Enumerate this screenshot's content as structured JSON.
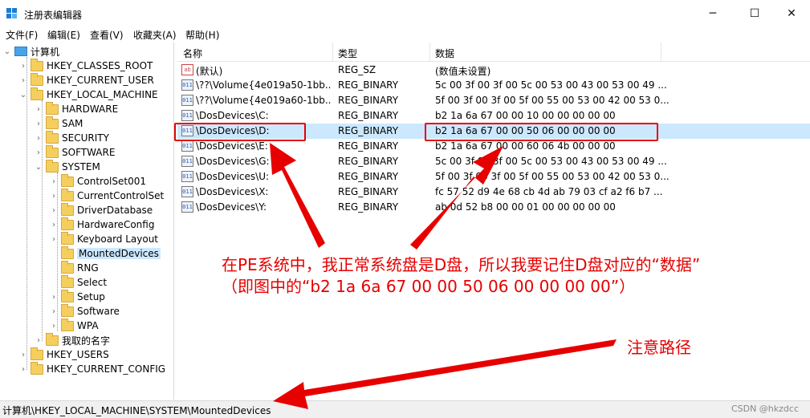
{
  "window": {
    "title": "注册表编辑器",
    "minimize": "─",
    "maximize": "☐",
    "close": "✕"
  },
  "menu": [
    "文件(F)",
    "编辑(E)",
    "查看(V)",
    "收藏夹(A)",
    "帮助(H)"
  ],
  "tree": {
    "root": "计算机",
    "hives": {
      "classes_root": "HKEY_CLASSES_ROOT",
      "current_user": "HKEY_CURRENT_USER",
      "local_machine": "HKEY_LOCAL_MACHINE",
      "users": "HKEY_USERS",
      "current_config": "HKEY_CURRENT_CONFIG"
    },
    "hklm_children": [
      "HARDWARE",
      "SAM",
      "SECURITY",
      "SOFTWARE",
      "SYSTEM",
      "我取的名字"
    ],
    "system_children": [
      "ControlSet001",
      "CurrentControlSet",
      "DriverDatabase",
      "HardwareConfig",
      "Keyboard Layout",
      "MountedDevices",
      "RNG",
      "Select",
      "Setup",
      "Software",
      "WPA"
    ]
  },
  "columns": {
    "name": "名称",
    "type": "类型",
    "data": "数据"
  },
  "rows": [
    {
      "icon": "ab",
      "name": "(默认)",
      "type": "REG_SZ",
      "data": "(数值未设置)"
    },
    {
      "icon": "011",
      "name": "\\??\\Volume{4e019a50-1bb...",
      "type": "REG_BINARY",
      "data": "5c 00 3f 00 3f 00 5c 00 53 00 43 00 53 00 49 ..."
    },
    {
      "icon": "011",
      "name": "\\??\\Volume{4e019a60-1bb...",
      "type": "REG_BINARY",
      "data": "5f 00 3f 00 3f 00 5f 00 55 00 53 00 42 00 53 0..."
    },
    {
      "icon": "011",
      "name": "\\DosDevices\\C:",
      "type": "REG_BINARY",
      "data": "b2 1a 6a 67 00 00 10 00 00 00 00 00"
    },
    {
      "icon": "011",
      "name": "\\DosDevices\\D:",
      "type": "REG_BINARY",
      "data": "b2 1a 6a 67 00 00 50 06 00 00 00 00"
    },
    {
      "icon": "011",
      "name": "\\DosDevices\\E:",
      "type": "REG_BINARY",
      "data": "b2 1a 6a 67 00 00 60 06 4b 00 00 00"
    },
    {
      "icon": "011",
      "name": "\\DosDevices\\G:",
      "type": "REG_BINARY",
      "data": "5c 00 3f 00 3f 00 5c 00 53 00 43 00 53 00 49 ..."
    },
    {
      "icon": "011",
      "name": "\\DosDevices\\U:",
      "type": "REG_BINARY",
      "data": "5f 00 3f 00 3f 00 5f 00 55 00 53 00 42 00 53 0..."
    },
    {
      "icon": "011",
      "name": "\\DosDevices\\X:",
      "type": "REG_BINARY",
      "data": "fc 57 52 d9 4e 68 cb 4d ab 79 03 cf a2 f6 b7 ..."
    },
    {
      "icon": "011",
      "name": "\\DosDevices\\Y:",
      "type": "REG_BINARY",
      "data": "ab 0d 52 b8 00 00 01 00 00 00 00 00"
    }
  ],
  "status": {
    "path": "计算机\\HKEY_LOCAL_MACHINE\\SYSTEM\\MountedDevices",
    "watermark": "CSDN @hkzdcc"
  },
  "annotations": {
    "line1": "在PE系统中，我正常系统盘是D盘，所以我要记住D盘对应的“数据”",
    "line2": "（即图中的“b2 1a 6a 67 00 00 50 06 00 00 00 00”）",
    "path_note": "注意路径"
  },
  "colors": {
    "accent": "#e60000",
    "selection": "#cce8ff"
  }
}
